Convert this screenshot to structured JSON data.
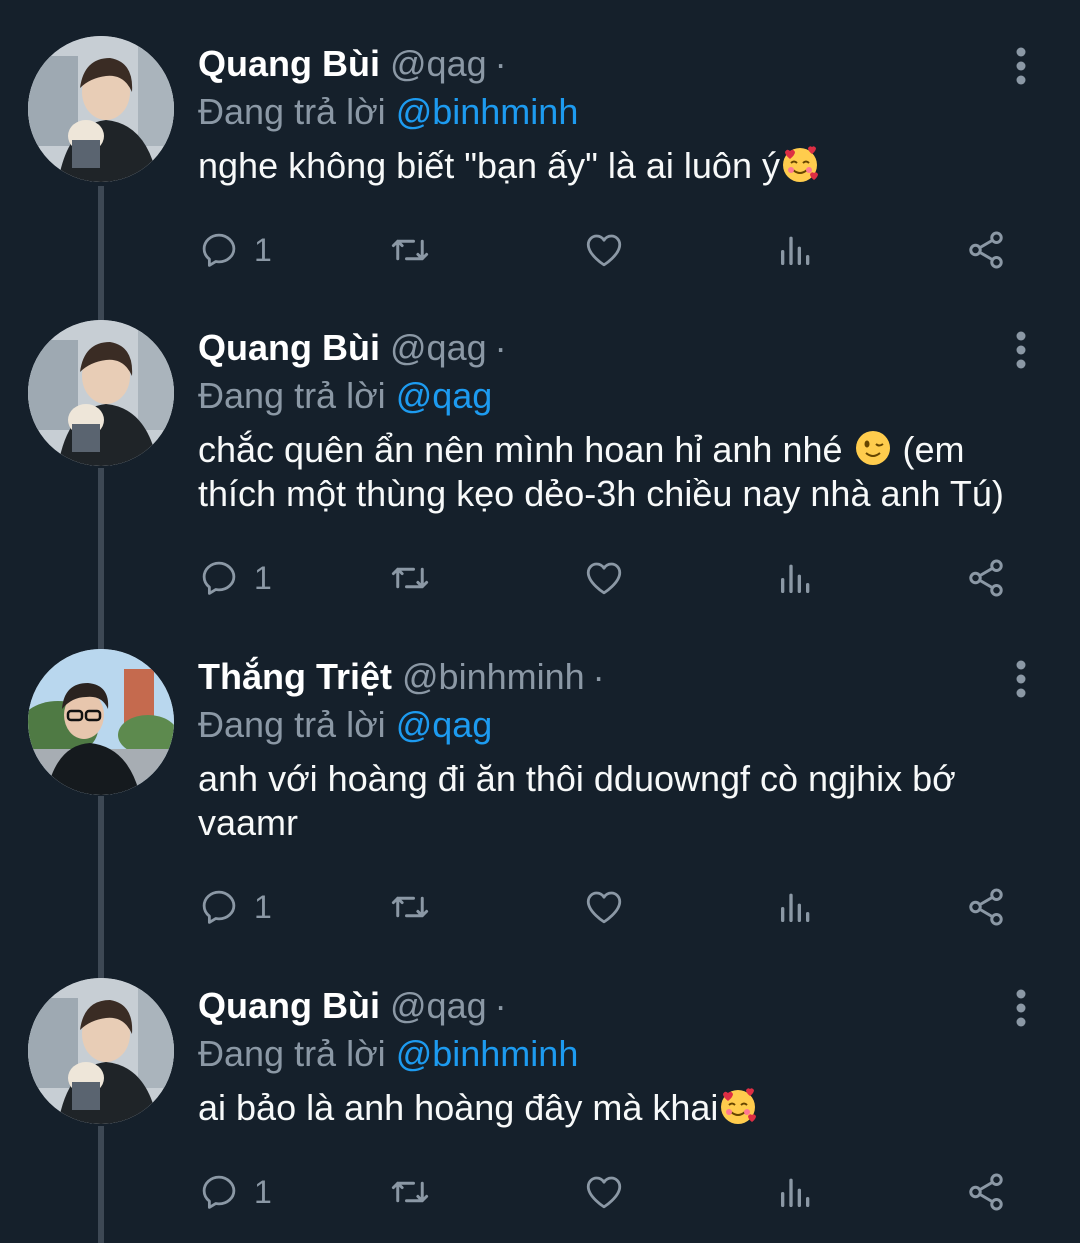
{
  "colors": {
    "background": "#15202b",
    "name": "#ffffff",
    "secondary_text": "#8b98a5",
    "mention": "#1d9bf0",
    "body_text": "#f7f9f9",
    "thread_line": "#3d4854"
  },
  "tweets": [
    {
      "display_name": "Quang Bùi",
      "handle": "@qag",
      "separator": "·",
      "reply_prefix": "Đang trả lời",
      "reply_to": "@binhminh",
      "text_parts": [
        "nghe không biết \"bạn ấy\" là ai luôn ý"
      ],
      "emoji": "smiling-face-with-hearts",
      "reply_count": "1"
    },
    {
      "display_name": "Quang Bùi",
      "handle": "@qag",
      "separator": "·",
      "reply_prefix": "Đang trả lời",
      "reply_to": "@qag",
      "text_parts": [
        "chắc quên ẩn nên mình hoan hỉ anh nhé ",
        " (em thích một thùng kẹo dẻo-3h chiều nay nhà anh Tú)"
      ],
      "emoji": "winking-face",
      "reply_count": "1"
    },
    {
      "display_name": "Thắng Triệt",
      "handle": "@binhminh",
      "separator": "·",
      "reply_prefix": "Đang trả lời",
      "reply_to": "@qag",
      "text_parts": [
        "anh với hoàng đi ăn thôi dduowngf cò ngjhix bớ vaamr"
      ],
      "emoji": "",
      "reply_count": "1"
    },
    {
      "display_name": "Quang Bùi",
      "handle": "@qag",
      "separator": "·",
      "reply_prefix": "Đang trả lời",
      "reply_to": "@binhminh",
      "text_parts": [
        "ai bảo là anh hoàng đây mà khai"
      ],
      "emoji": "smiling-face-with-hearts",
      "reply_count": "1"
    }
  ],
  "icons": {
    "reply": "reply-icon",
    "retweet": "retweet-icon",
    "like": "heart-icon",
    "views": "views-icon",
    "share": "share-icon",
    "more": "more-vertical-icon"
  }
}
